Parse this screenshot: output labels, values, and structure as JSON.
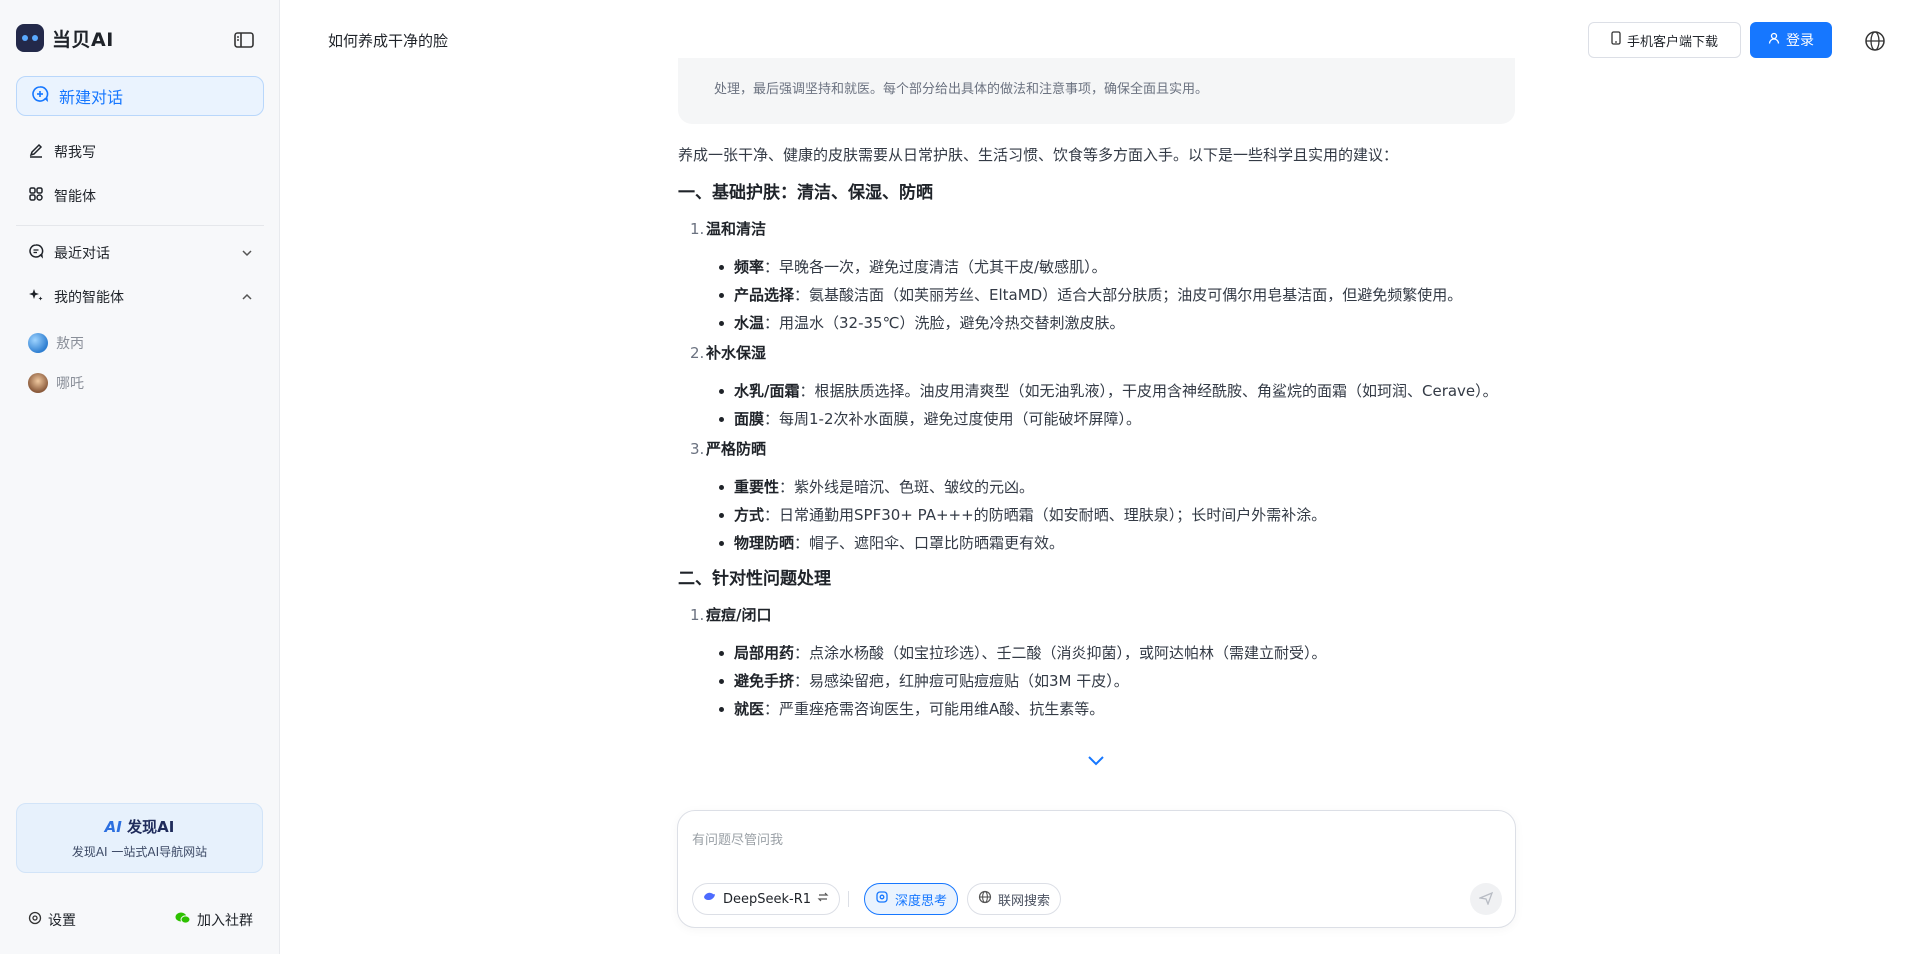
{
  "sidebar": {
    "brand": "当贝AI",
    "new_chat": "新建对话",
    "nav": {
      "write": "帮我写",
      "agents": "智能体",
      "recent": "最近对话",
      "my_agents": "我的智能体"
    },
    "my_agents_list": [
      "敖丙",
      "哪吒"
    ],
    "promo": {
      "logo": "发现AI",
      "subtitle": "发现AI 一站式AI导航网站"
    },
    "footer": {
      "settings": "设置",
      "join": "加入社群"
    }
  },
  "header": {
    "title": "如何养成干净的脸",
    "download_label": "手机客户端下载",
    "login_label": "登录"
  },
  "thinking": {
    "tail": "处理，最后强调坚持和就医。每个部分给出具体的做法和注意事项，确保全面且实用。"
  },
  "answer": {
    "intro": "养成一张干净、健康的皮肤需要从日常护肤、生活习惯、饮食等多方面入手。以下是一些科学且实用的建议：",
    "section1": {
      "title": "一、基础护肤：清洁、保湿、防晒",
      "sub1": {
        "num": "1.",
        "title": "温和清洁",
        "items": [
          {
            "k": "频率",
            "v": "：早晚各一次，避免过度清洁（尤其干皮/敏感肌）。"
          },
          {
            "k": "产品选择",
            "v": "：氨基酸洁面（如芙丽芳丝、EltaMD）适合大部分肤质；油皮可偶尔用皂基洁面，但避免频繁使用。"
          },
          {
            "k": "水温",
            "v": "：用温水（32-35℃）洗脸，避免冷热交替刺激皮肤。"
          }
        ]
      },
      "sub2": {
        "num": "2.",
        "title": "补水保湿",
        "items": [
          {
            "k": "水乳/面霜",
            "v": "：根据肤质选择。油皮用清爽型（如无油乳液），干皮用含神经酰胺、角鲨烷的面霜（如珂润、Cerave）。"
          },
          {
            "k": "面膜",
            "v": "：每周1-2次补水面膜，避免过度使用（可能破坏屏障）。"
          }
        ]
      },
      "sub3": {
        "num": "3.",
        "title": "严格防晒",
        "items": [
          {
            "k": "重要性",
            "v": "：紫外线是暗沉、色斑、皱纹的元凶。"
          },
          {
            "k": "方式",
            "v": "：日常通勤用SPF30+ PA+++的防晒霜（如安耐晒、理肤泉）；长时间户外需补涂。"
          },
          {
            "k": "物理防晒",
            "v": "：帽子、遮阳伞、口罩比防晒霜更有效。"
          }
        ]
      }
    },
    "section2": {
      "title": "二、针对性问题处理",
      "sub1": {
        "num": "1.",
        "title": "痘痘/闭口",
        "items": [
          {
            "k": "局部用药",
            "v": "：点涂水杨酸（如宝拉珍选）、壬二酸（消炎抑菌），或阿达帕林（需建立耐受）。"
          },
          {
            "k": "避免手挤",
            "v": "：易感染留疤，红肿痘可贴痘痘贴（如3M 干皮）。"
          },
          {
            "k": "就医",
            "v": "：严重痤疮需咨询医生，可能用维A酸、抗生素等。"
          }
        ]
      }
    }
  },
  "composer": {
    "placeholder": "有问题尽管问我",
    "model": "DeepSeek-R1",
    "deep_think": "深度思考",
    "web_search": "联网搜索"
  },
  "colors": {
    "accent": "#1677ff",
    "sidebar_bg": "#f7f8fa"
  }
}
